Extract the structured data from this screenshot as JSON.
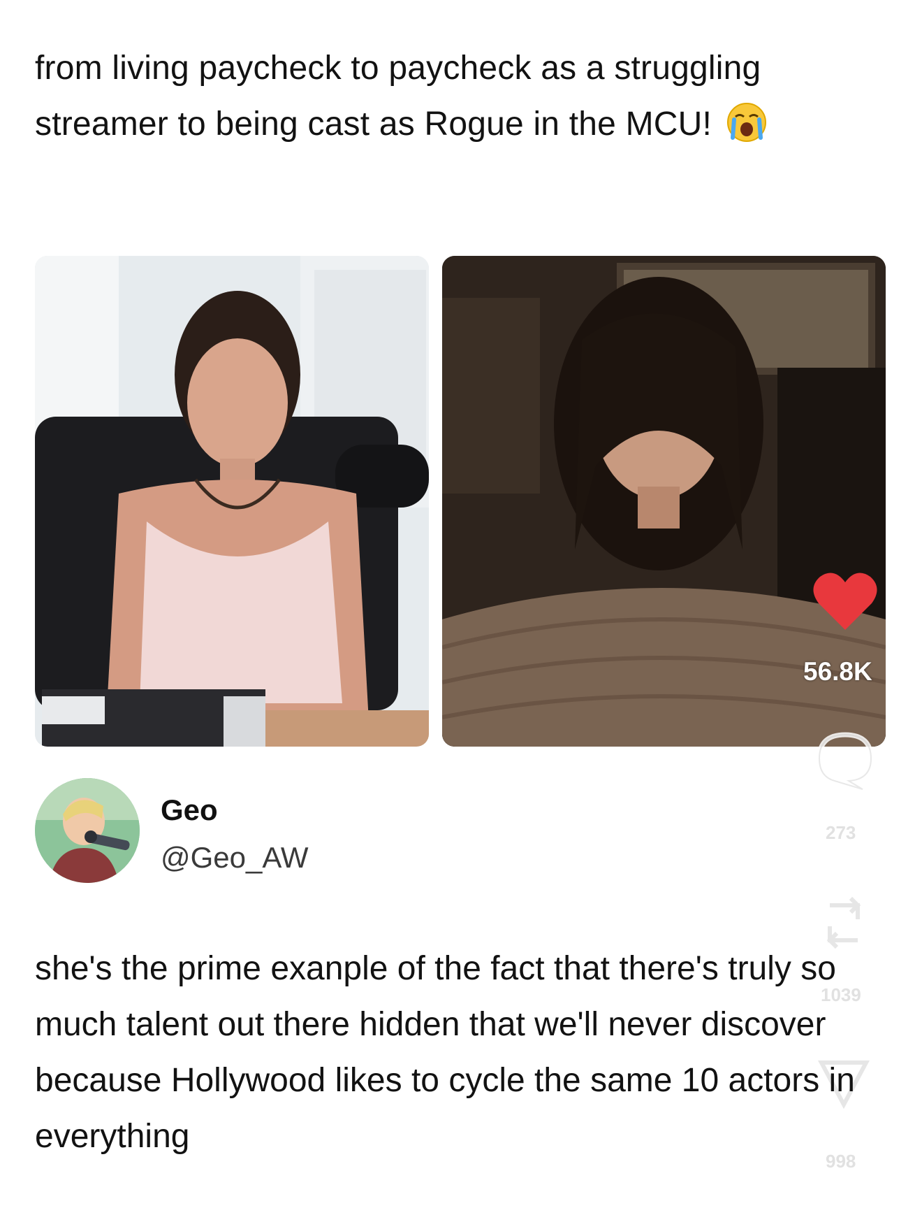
{
  "post": {
    "caption": "from living paycheck to paycheck as a struggling streamer to being cast as Rogue in the MCU!",
    "caption_emoji": "loudly-crying-face-emoji"
  },
  "images": {
    "left": "streamer-photo",
    "right": "actress-photo"
  },
  "overlay": {
    "like_icon": "heart-icon",
    "like_count": "56.8K",
    "comment_icon": "comment-icon",
    "comment_count": "273",
    "repost_icon": "repost-icon",
    "repost_count": "1039",
    "share_icon": "share-icon",
    "share_count": "998",
    "like_color": "#e8383d"
  },
  "author": {
    "name": "Geo",
    "handle": "@Geo_AW"
  },
  "tweet": {
    "text": "she's the prime exanple of the fact that there's truly so much talent out there hidden that we'll never discover because Hollywood likes to cycle the same 10 actors in everything"
  }
}
